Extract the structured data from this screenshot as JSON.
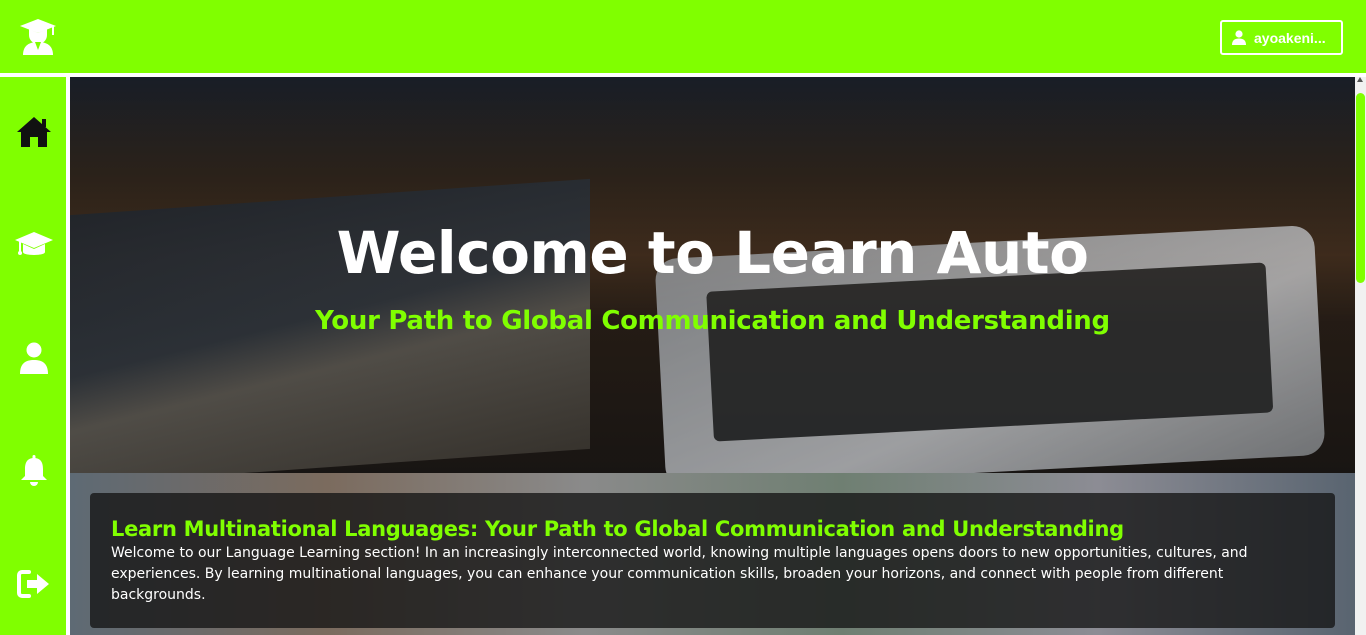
{
  "app": {
    "accent_color": "#80ff00",
    "logo_icon": "graduate-icon"
  },
  "header": {
    "user_label": "ayoakeni...",
    "user_icon": "user-icon"
  },
  "sidebar": {
    "items": [
      {
        "name": "home",
        "icon": "home-icon"
      },
      {
        "name": "courses",
        "icon": "graduation-cap-icon"
      },
      {
        "name": "profile",
        "icon": "user-icon"
      },
      {
        "name": "notifications",
        "icon": "bell-icon"
      },
      {
        "name": "logout",
        "icon": "sign-out-icon"
      }
    ]
  },
  "hero": {
    "title": "Welcome to Learn Auto",
    "subtitle": "Your Path to Global Communication and Understanding"
  },
  "section": {
    "title": "Learn Multinational Languages: Your Path to Global Communication and Understanding",
    "body": "Welcome to our Language Learning section! In an increasingly interconnected world, knowing multiple languages opens doors to new opportunities, cultures, and experiences. By learning multinational languages, you can enhance your communication skills, broaden your horizons, and connect with people from different backgrounds."
  }
}
